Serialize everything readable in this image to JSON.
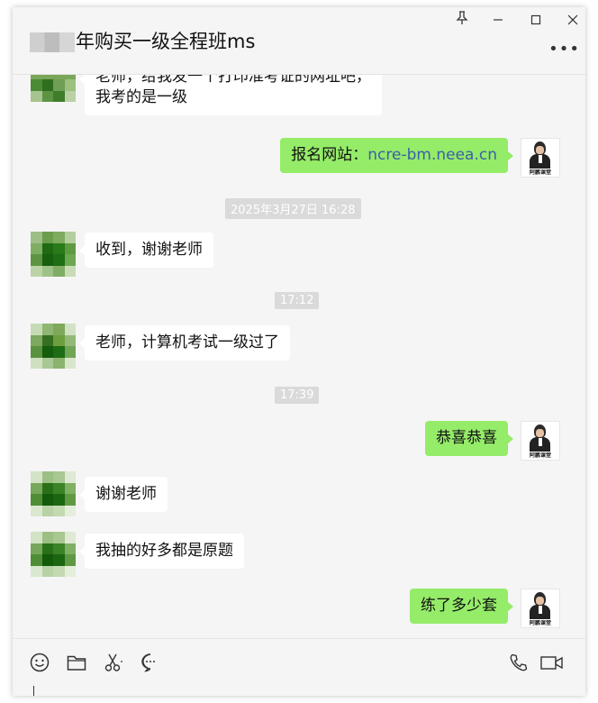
{
  "window": {
    "title": "年购买一级全程班ms",
    "controls": {
      "pin": "⚲",
      "minimize": "—",
      "maximize": "☐",
      "close": "✕"
    },
    "more": "•••"
  },
  "messages": {
    "partial_in": {
      "line1": "老师，给我发一个打印准考证的网址吧，",
      "line2": "我考的是一级"
    },
    "out1": {
      "prefix": "报名网站：",
      "link": "ncre-bm.neea.cn"
    },
    "ts1": "2025年3月27日 16:28",
    "in1": "收到，谢谢老师",
    "ts2": "17:12",
    "in2": "老师，计算机考试一级过了",
    "ts3": "17:39",
    "out2": "恭喜恭喜",
    "in3": "谢谢老师",
    "in4": "我抽的好多都是原题",
    "out3": "练了多少套"
  },
  "avatar_tag": "阿鹏课堂",
  "toolbar": {
    "icons": [
      "emoji-icon",
      "folder-icon",
      "scissors-icon",
      "chat-history-icon",
      "phone-icon",
      "video-call-icon"
    ]
  },
  "colors": {
    "outgoing_bubble": "#95ec69",
    "incoming_bubble": "#ffffff",
    "link": "#3c5fa8",
    "background": "#f5f5f5"
  }
}
